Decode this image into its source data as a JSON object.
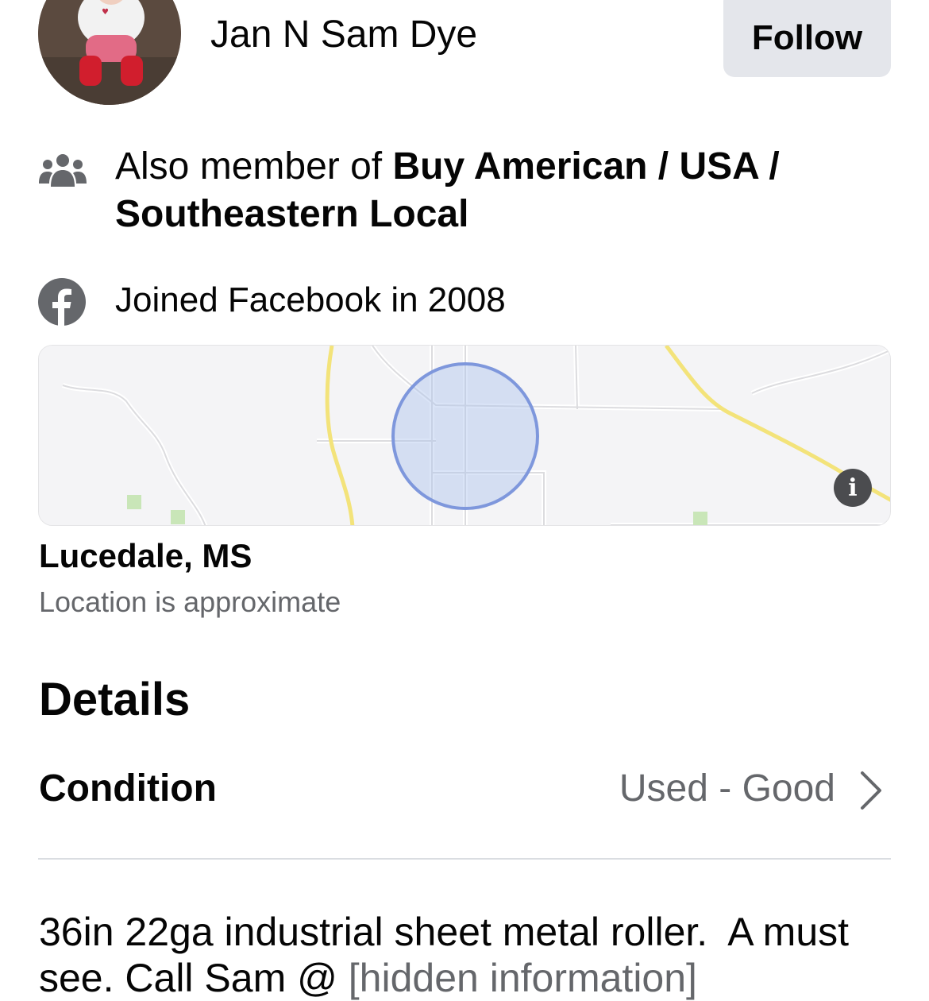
{
  "seller": {
    "name": "Jan N Sam Dye",
    "follow_label": "Follow",
    "avatar_alt": "Seller profile photo"
  },
  "info": {
    "groups_prefix": "Also member of ",
    "groups_name": "Buy American / USA / Southeastern Local",
    "joined": "Joined Facebook in 2008"
  },
  "map": {
    "info_button": "i"
  },
  "location": {
    "name": "Lucedale, MS",
    "note": "Location is approximate"
  },
  "details": {
    "heading": "Details",
    "condition_label": "Condition",
    "condition_value": "Used - Good"
  },
  "description": {
    "text": "36in 22ga industrial sheet metal roller.  A must see. Call Sam @ ",
    "hidden": "[hidden information]"
  },
  "colors": {
    "secondary_text": "#65676b",
    "button_bg": "#e4e6eb",
    "map_circle": "#7e97dc",
    "map_road_yellow": "#f3e37a"
  }
}
